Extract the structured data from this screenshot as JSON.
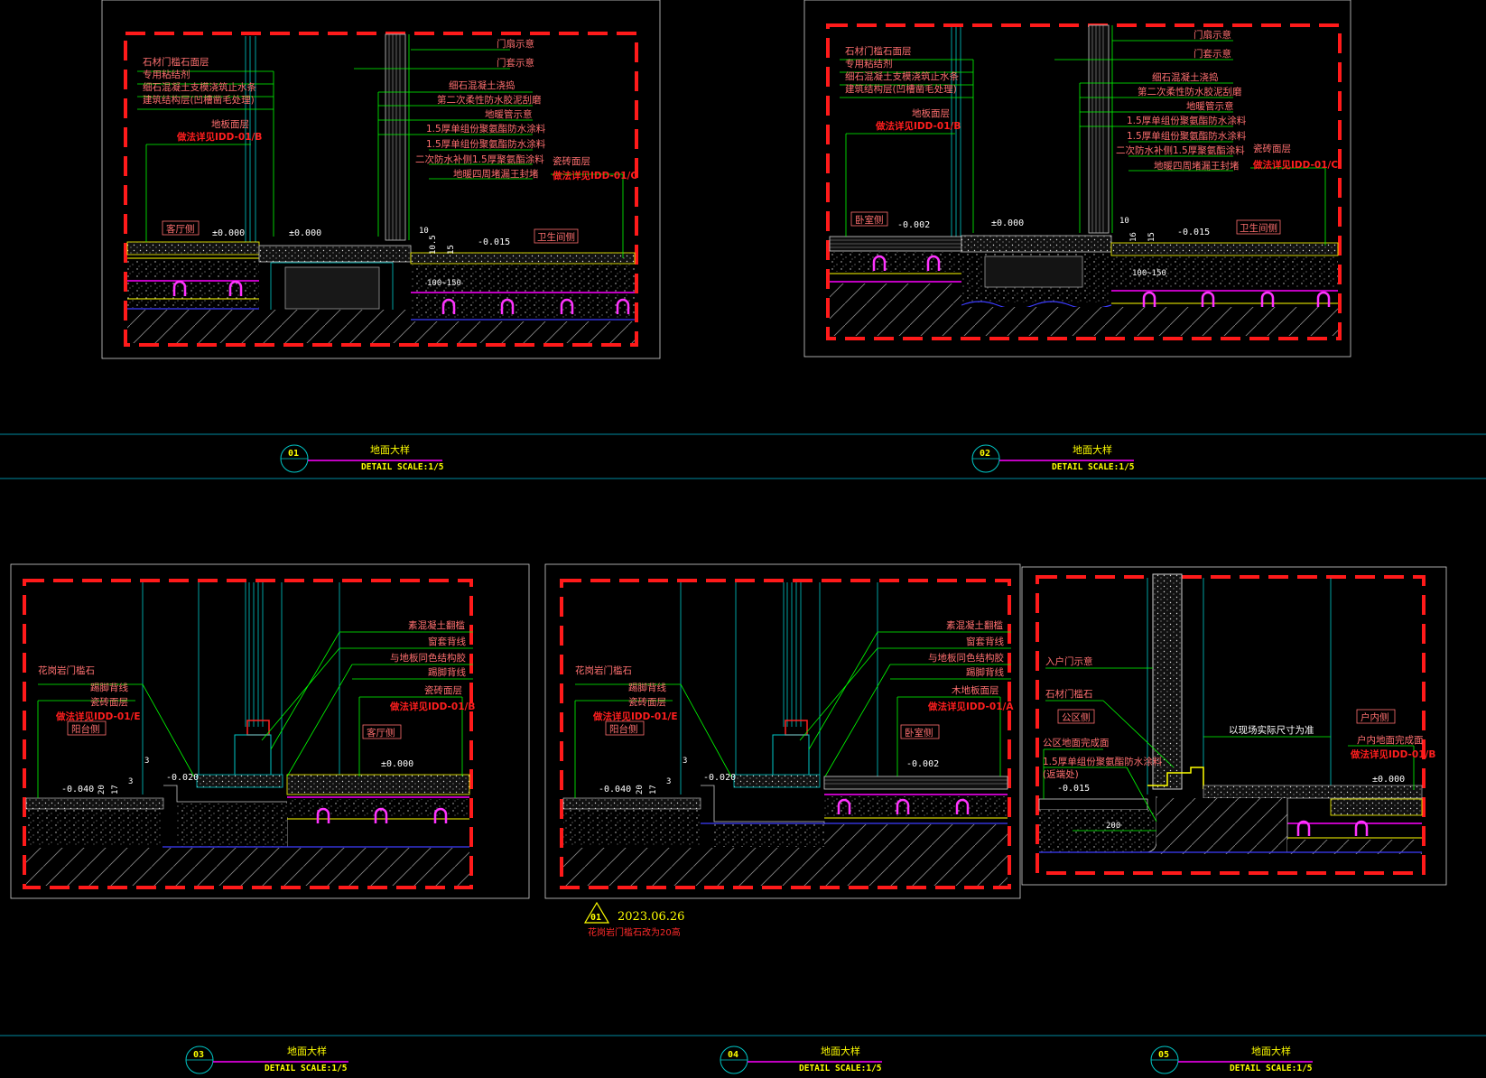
{
  "details": [
    {
      "number": "01",
      "title": "地面大样",
      "subtitle": "DETAIL   SCALE:1/5",
      "labels_left": [
        "石材门槛石面层",
        "专用粘结剂",
        "细石混凝土支模浇筑止水条",
        "建筑结构层(凹槽凿毛处理)"
      ],
      "labels_floor": [
        "地板面层",
        "做法详见IDD-01/B"
      ],
      "labels_right": [
        "门扇示意",
        "门套示意",
        "细石混凝土浇捣",
        "第二次柔性防水胶泥刮磨",
        "地暖管示意",
        "1.5厚单组份聚氨酯防水涂料",
        "1.5厚单组份聚氨酯防水涂料",
        "二次防水补侧1.5厚聚氨酯涂料",
        "地暖四周堵漏王封堵"
      ],
      "labels_tile": [
        "瓷砖面层",
        "做法详见IDD-01/C"
      ],
      "room_left": "客厅侧",
      "room_right": "卫生间侧",
      "elev": [
        "±0.000",
        "±0.000",
        "-0.015"
      ],
      "dims": [
        "10",
        "10.5",
        "15",
        "100~150"
      ]
    },
    {
      "number": "02",
      "title": "地面大样",
      "subtitle": "DETAIL   SCALE:1/5",
      "labels_left": [
        "石材门槛石面层",
        "专用粘结剂",
        "细石混凝土支模浇筑止水条",
        "建筑结构层(凹槽凿毛处理)"
      ],
      "labels_floor": [
        "地板面层",
        "做法详见IDD-01/B"
      ],
      "labels_right": [
        "门扇示意",
        "门套示意",
        "细石混凝土浇捣",
        "第二次柔性防水胶泥刮磨",
        "地暖管示意",
        "1.5厚单组份聚氨酯防水涂料",
        "1.5厚单组份聚氨酯防水涂料",
        "二次防水补侧1.5厚聚氨酯涂料",
        "地暖四周堵漏王封堵"
      ],
      "labels_tile": [
        "瓷砖面层",
        "做法详见IDD-01/C"
      ],
      "room_left": "卧室侧",
      "room_right": "卫生间侧",
      "elev": [
        "-0.002",
        "±0.000",
        "-0.015"
      ],
      "dims": [
        "10",
        "16",
        "15",
        "100~150"
      ]
    },
    {
      "number": "03",
      "title": "地面大样",
      "subtitle": "DETAIL   SCALE:1/5",
      "labels_left": [
        "花岗岩门槛石",
        "踢脚背线",
        "瓷砖面层",
        "做法详见IDD-01/E"
      ],
      "room_left": "阳台侧",
      "labels_right": [
        "素混凝土翻槛",
        "窗套背线",
        "与地板同色结构胶",
        "踢脚背线"
      ],
      "labels_floor": [
        "瓷砖面层",
        "做法详见IDD-01/B"
      ],
      "room_right": "客厅侧",
      "elev": [
        "-0.040",
        "-0.020",
        "±0.000"
      ],
      "dims": [
        "3",
        "20",
        "17",
        "3"
      ]
    },
    {
      "number": "04",
      "title": "地面大样",
      "subtitle": "DETAIL   SCALE:1/5",
      "labels_left": [
        "花岗岩门槛石",
        "踢脚背线",
        "瓷砖面层",
        "做法详见IDD-01/E"
      ],
      "room_left": "阳台侧",
      "labels_right": [
        "素混凝土翻槛",
        "窗套背线",
        "与地板同色结构胶",
        "踢脚背线"
      ],
      "labels_floor": [
        "木地板面层",
        "做法详见IDD-01/A"
      ],
      "room_right": "卧室侧",
      "elev": [
        "-0.040",
        "-0.020",
        "-0.002"
      ],
      "dims": [
        "3",
        "20",
        "17",
        "3"
      ]
    },
    {
      "number": "05",
      "title": "地面大样",
      "subtitle": "DETAIL   SCALE:1/5",
      "labels_left": [
        "入户门示意",
        "石材门槛石",
        "公区地面完成面",
        "1.5厚单组份聚氨酯防水涂料",
        "(返端处)"
      ],
      "room_left": "公区侧",
      "room_right": "户内侧",
      "note_center": "以现场实际尺寸为准",
      "labels_floor": [
        "户内地面完成面",
        "做法详见IDD-01/B"
      ],
      "elev": [
        "-0.015",
        "±0.000"
      ],
      "dims": [
        "200"
      ]
    }
  ],
  "revision": {
    "tag": "01",
    "date": "2023.06.26",
    "note": "花岗岩门槛石改为20高"
  },
  "colors": {
    "background": "#000000",
    "border_dash": "#ff1a1a",
    "leader": "#00ff00",
    "title": "#ffff00",
    "cyan": "#00c8c8",
    "magenta": "#ff00ff"
  }
}
